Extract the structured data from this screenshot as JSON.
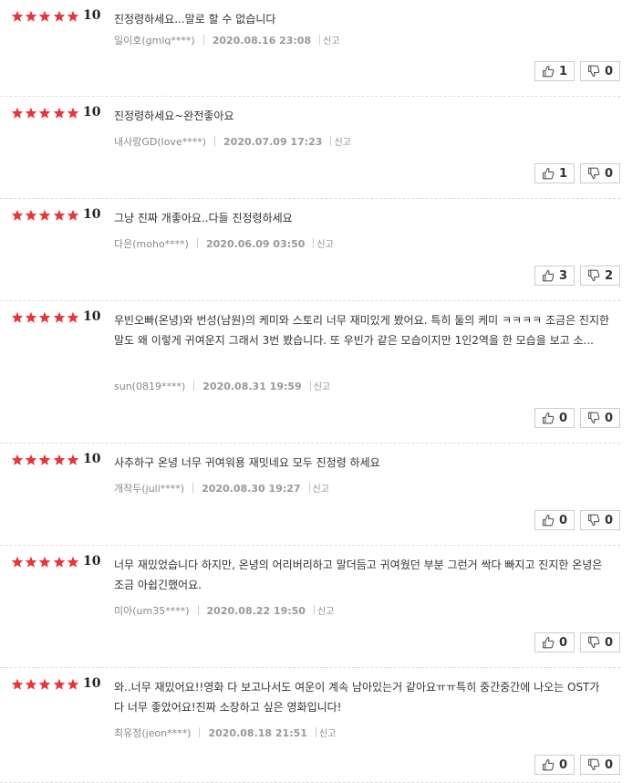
{
  "reviews": [
    {
      "stars": 5,
      "score": "10",
      "text": "진정령하세요...말로 할 수 없습니다",
      "nick": "일이호(gmlq****)",
      "date": "2020.08.16 23:08",
      "report": "신고",
      "likes": "1",
      "dislikes": "0"
    },
    {
      "stars": 5,
      "score": "10",
      "text": "진정령하세요~완전좋아요",
      "nick": "내사랑GD(love****)",
      "date": "2020.07.09 17:23",
      "report": "신고",
      "likes": "1",
      "dislikes": "0"
    },
    {
      "stars": 5,
      "score": "10",
      "text": "그냥 진짜 개좋아요..다들 진정령하세요",
      "nick": "다은(moho****)",
      "date": "2020.06.09 03:50",
      "report": "신고",
      "likes": "3",
      "dislikes": "2"
    },
    {
      "stars": 5,
      "score": "10",
      "text": "우빈오빠(온녕)와 번성(남원)의 케미와 스토리 너무 재미있게 봤어요. 특히 둘의 케미 ㅋㅋㅋㅋ 조금은 진지한 말도 왜 이렇게 귀여운지 그래서 3번 봤습니다. 또 우빈가 같은 모습이지만 1인2역을 한 모습을 보고 소...",
      "nick": "sun(0819****)",
      "date": "2020.08.31 19:59",
      "report": "신고",
      "likes": "0",
      "dislikes": "0"
    },
    {
      "stars": 5,
      "score": "10",
      "text": "사추하구 온녕 너무 귀여워용 재밋네요 모두 진정령 하세요",
      "nick": "개작두(juli****)",
      "date": "2020.08.30 19:27",
      "report": "신고",
      "likes": "0",
      "dislikes": "0"
    },
    {
      "stars": 5,
      "score": "10",
      "text": "너무 재밌었습니다 하지만, 온녕의 어리버리하고 말더듬고 귀여웠던 부분 그런거 싹다 빠지고 진지한 온녕은 조금 아쉽긴했어요.",
      "nick": "미아(um35****)",
      "date": "2020.08.22 19:50",
      "report": "신고",
      "likes": "0",
      "dislikes": "0"
    },
    {
      "stars": 5,
      "score": "10",
      "text": "와..너무 재밌어요!!영화 다 보고나서도 여운이 계속 남아있는거 같아요ㅠㅠ특히 중간중간에 나오는 OST가 다 너무 좋았어요!진짜 소장하고 싶은 영화입니다!",
      "nick": "최유정(jeon****)",
      "date": "2020.08.18 21:51",
      "report": "신고",
      "likes": "0",
      "dislikes": "0"
    }
  ],
  "colors": {
    "star": "#e8343a",
    "border": "#cccccc"
  },
  "icons": {
    "like": "thumbs-up-icon",
    "dislike": "thumbs-down-icon",
    "star": "star-icon"
  }
}
